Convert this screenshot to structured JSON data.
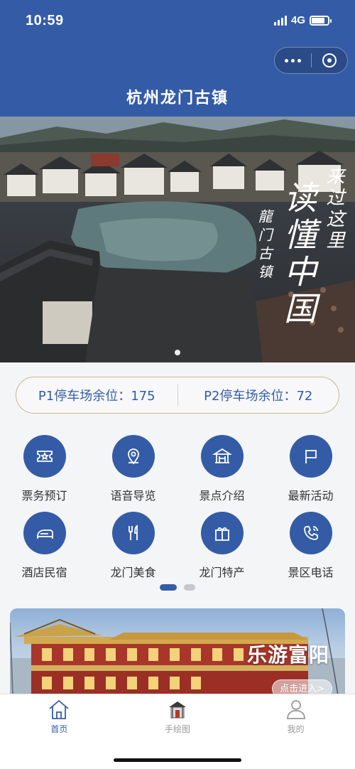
{
  "status_bar": {
    "time": "10:59",
    "network": "4G",
    "battery_level": 0.8
  },
  "mini_program": {
    "more_icon": "more-dots-icon",
    "close_icon": "capsule-close-icon"
  },
  "header": {
    "title": "杭州龙门古镇"
  },
  "banner": {
    "calligraphy_lines": [
      "来过这里",
      "读懂中国",
      "龍门古镇"
    ],
    "slide_count": 1,
    "active_slide": 1
  },
  "parking": {
    "p1_label": "P1停车场余位：175",
    "p2_label": "P2停车场余位：72"
  },
  "menu": [
    {
      "label": "票务预订",
      "icon": "ticket-icon"
    },
    {
      "label": "语音导览",
      "icon": "location-pin-icon"
    },
    {
      "label": "景点介绍",
      "icon": "pavilion-icon"
    },
    {
      "label": "最新活动",
      "icon": "flag-icon"
    },
    {
      "label": "酒店民宿",
      "icon": "bed-icon"
    },
    {
      "label": "龙门美食",
      "icon": "fork-knife-icon"
    },
    {
      "label": "龙门特产",
      "icon": "gift-icon"
    },
    {
      "label": "景区电话",
      "icon": "phone-icon"
    }
  ],
  "menu_pages": {
    "total": 2,
    "active": 1
  },
  "promo": {
    "title": "乐游富阳",
    "button": "点击进入>"
  },
  "tabbar": [
    {
      "label": "首页",
      "icon": "home-icon",
      "active": true
    },
    {
      "label": "手绘图",
      "icon": "hand-drawn-map-icon",
      "active": false
    },
    {
      "label": "我的",
      "icon": "user-icon",
      "active": false
    }
  ],
  "colors": {
    "primary": "#345ca6",
    "gold_border": "#c9b98f",
    "tab_inactive": "#999999"
  }
}
